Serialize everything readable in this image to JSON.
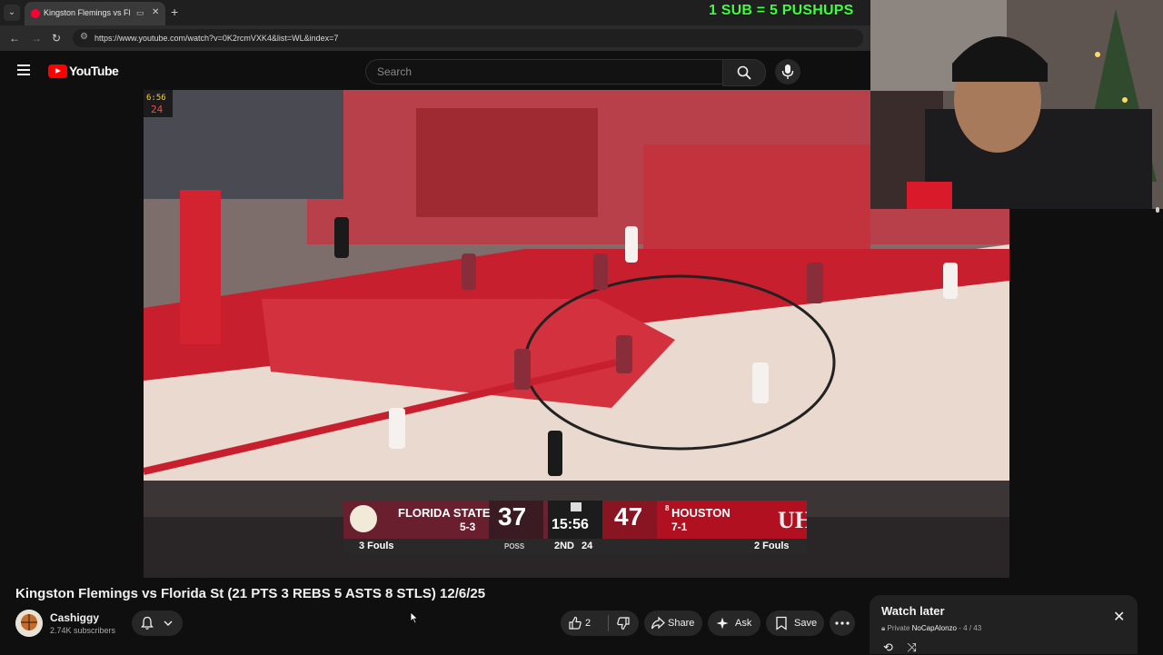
{
  "browser": {
    "tab_title": "Kingston Flemings vs Florid",
    "tab_close": "✕",
    "new_tab": "+",
    "url": "https://www.youtube.com/watch?v=0K2rcmVXK4&list=WL&index=7"
  },
  "overlay": {
    "promo_text": "1 SUB = 5 PUSHUPS"
  },
  "youtube": {
    "logo_text": "YouTube",
    "search_placeholder": "Search"
  },
  "scoreboard": {
    "away_team": "FLORIDA STATE",
    "away_record": "5-3",
    "away_score": "37",
    "away_fouls": "3 Fouls",
    "clock": "15:56",
    "period": "2ND",
    "shot_clock": "24",
    "poss": "POSS",
    "home_rank": "8",
    "home_team": "HOUSTON",
    "home_record": "7-1",
    "home_score": "47",
    "home_fouls": "2 Fouls",
    "corner_clock": "6:56",
    "corner_shot": "24"
  },
  "video_info": {
    "title": "Kingston Flemings vs Florida St (21 PTS 3 REBS 5 ASTS 8 STLS) 12/6/25",
    "channel": "Cashiggy",
    "subscribers": "2.74K subscribers",
    "likes": "2",
    "share_label": "Share",
    "ask_label": "Ask",
    "save_label": "Save"
  },
  "playlist": {
    "title": "Watch later",
    "privacy": "Private",
    "owner": "NoCapAlonzo",
    "position": "4 / 43"
  }
}
